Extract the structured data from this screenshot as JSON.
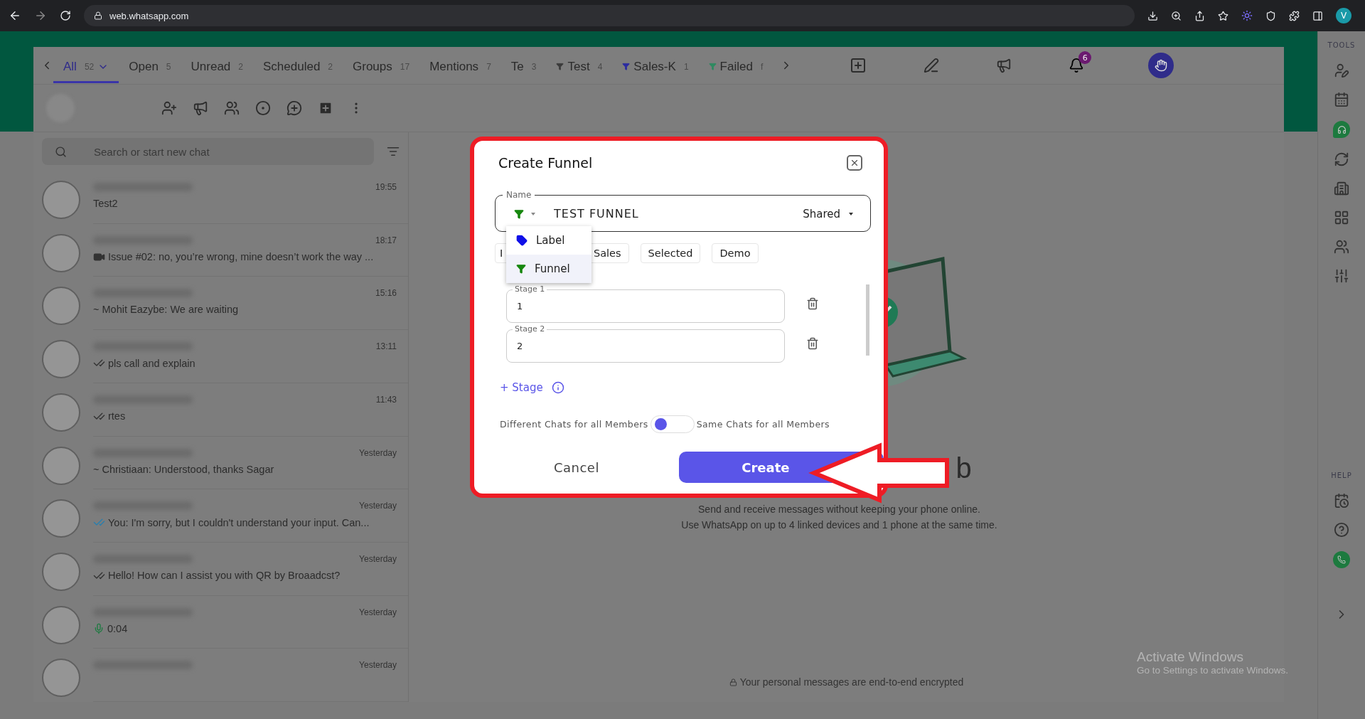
{
  "browser": {
    "url": "web.whatsapp.com",
    "profile_initial": "V"
  },
  "tabs": [
    {
      "label": "All",
      "count": "52",
      "selected": true,
      "kind": "plain"
    },
    {
      "label": "Open",
      "count": "5",
      "selected": false,
      "kind": "plain"
    },
    {
      "label": "Unread",
      "count": "2",
      "selected": false,
      "kind": "plain"
    },
    {
      "label": "Scheduled",
      "count": "2",
      "selected": false,
      "kind": "plain"
    },
    {
      "label": "Groups",
      "count": "17",
      "selected": false,
      "kind": "plain"
    },
    {
      "label": "Mentions",
      "count": "7",
      "selected": false,
      "kind": "plain"
    },
    {
      "label": "Te",
      "count": "3",
      "selected": false,
      "kind": "plain"
    },
    {
      "label": "Test",
      "count": "4",
      "selected": false,
      "kind": "funnel",
      "color": "#3b3b3b"
    },
    {
      "label": "Sales-K",
      "count": "1",
      "selected": false,
      "kind": "funnel",
      "color": "#2b2ba0"
    },
    {
      "label": "Failed",
      "count": "f",
      "selected": false,
      "kind": "funnel",
      "color": "#2e8a60"
    }
  ],
  "notification_count": "6",
  "search": {
    "placeholder": "Search or start new chat"
  },
  "chats": [
    {
      "time": "19:55",
      "preview": "Test2",
      "kind": "text"
    },
    {
      "time": "18:17",
      "preview": "Issue #02: no, you’re wrong, mine doesn’t work the way ...",
      "kind": "video"
    },
    {
      "time": "15:16",
      "preview": "~ Mohit Eazybe: We are waiting",
      "kind": "text"
    },
    {
      "time": "13:11",
      "preview": "pls call and explain",
      "kind": "delivered"
    },
    {
      "time": "11:43",
      "preview": "rtes",
      "kind": "delivered"
    },
    {
      "time": "Yesterday",
      "preview": "~ Christiaan: Understood, thanks Sagar",
      "kind": "text"
    },
    {
      "time": "Yesterday",
      "preview": "You: I'm sorry, but I couldn't understand your input. Can...",
      "kind": "read"
    },
    {
      "time": "Yesterday",
      "preview": "Hello! How can I assist you with QR by Broaadcst?",
      "kind": "delivered"
    },
    {
      "time": "Yesterday",
      "preview": "0:04",
      "kind": "voice"
    },
    {
      "time": "Yesterday"
    }
  ],
  "welcome": {
    "title_fragment": "b",
    "lines": [
      "Send and receive messages without keeping your phone online.",
      "Use WhatsApp on up to 4 linked devices and 1 phone at the same time."
    ],
    "encrypted": "Your personal messages are end-to-end encrypted"
  },
  "os_notice": {
    "title": "Activate Windows",
    "subtitle": "Go to Settings to activate Windows."
  },
  "tools": {
    "tools_label": "TOOLS",
    "help_label": "HELP"
  },
  "dialog": {
    "title": "Create Funnel",
    "name_label": "Name",
    "name_value": "TEST FUNNEL",
    "visibility": "Shared",
    "type_menu": [
      {
        "label": "Label",
        "kind": "label",
        "selected": false
      },
      {
        "label": "Funnel",
        "kind": "funnel",
        "selected": true
      }
    ],
    "chips": [
      "I",
      "Sales",
      "Selected",
      "Demo"
    ],
    "stages": [
      {
        "label": "Stage 1",
        "value": "1"
      },
      {
        "label": "Stage 2",
        "value": "2"
      }
    ],
    "add_stage": "+ Stage",
    "toggle": {
      "left": "Different Chats for all Members",
      "right": "Same Chats for all Members",
      "on": false
    },
    "cancel": "Cancel",
    "create": "Create"
  }
}
